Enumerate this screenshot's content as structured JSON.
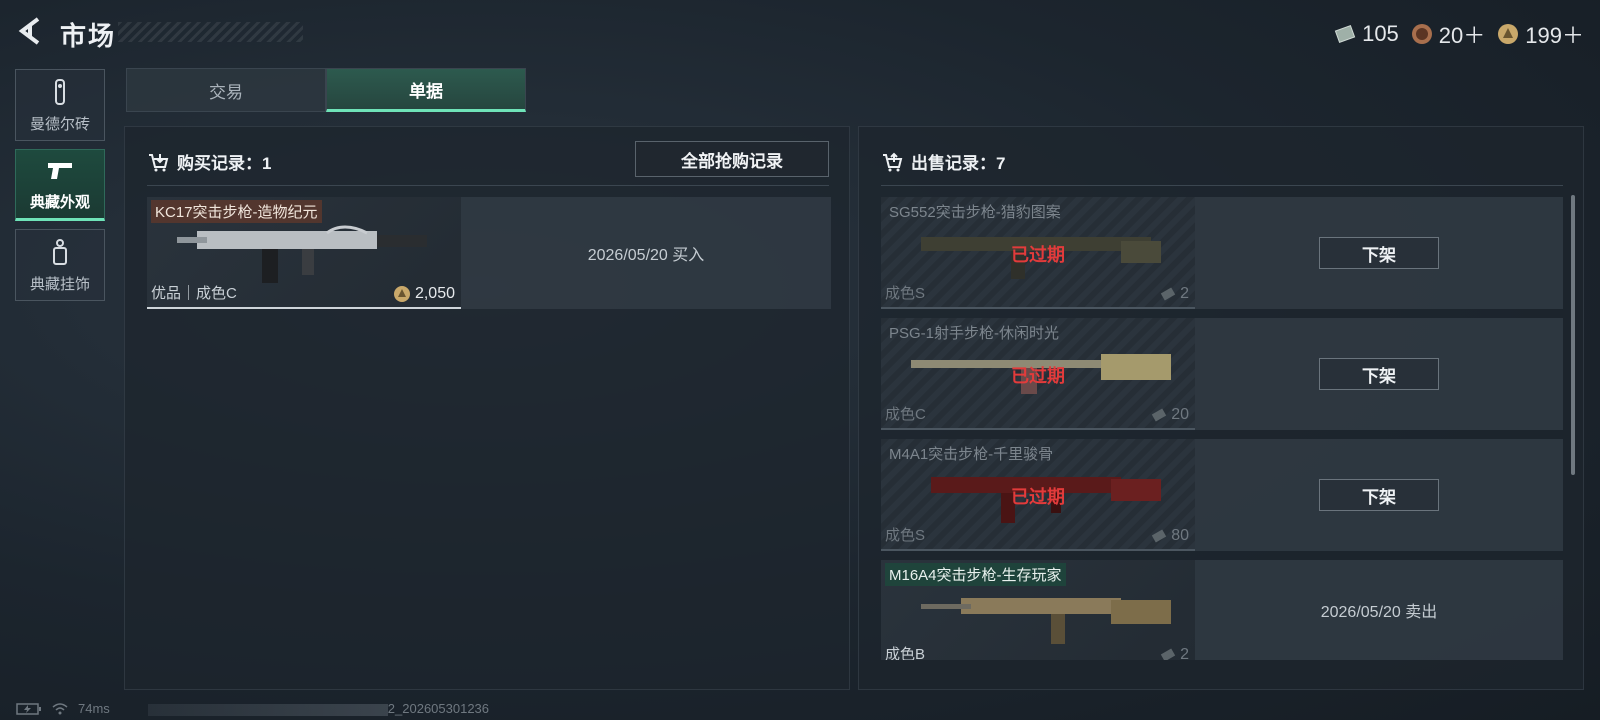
{
  "header": {
    "title": "市场",
    "currencies": [
      {
        "icon": "ticket-icon",
        "value": "105"
      },
      {
        "icon": "badge-coin-icon",
        "value": "20＋"
      },
      {
        "icon": "gold-coin-icon",
        "value": "199＋"
      }
    ]
  },
  "sidebar": {
    "items": [
      {
        "label": "曼德尔砖",
        "icon": "brick-icon",
        "active": false
      },
      {
        "label": "典藏外观",
        "icon": "pistol-icon",
        "active": true
      },
      {
        "label": "典藏挂饰",
        "icon": "charm-icon",
        "active": false
      }
    ]
  },
  "tabs": [
    {
      "label": "交易",
      "active": false
    },
    {
      "label": "单据",
      "active": true
    }
  ],
  "purchase": {
    "heading": "购买记录：1",
    "all_button": "全部抢购记录",
    "records": [
      {
        "name": "KC17突击步枪-造物纪元",
        "grade": "优品｜成色C",
        "price": "2,050",
        "info": "2026/05/20 买入"
      }
    ]
  },
  "sales": {
    "heading": "出售记录：7",
    "records": [
      {
        "name": "SG552突击步枪-猎豹图案",
        "grade": "成色S",
        "qty": "2",
        "expired": "已过期",
        "action": "下架"
      },
      {
        "name": "PSG-1射手步枪-休闲时光",
        "grade": "成色C",
        "qty": "20",
        "expired": "已过期",
        "action": "下架"
      },
      {
        "name": "M4A1突击步枪-千里骏骨",
        "grade": "成色S",
        "qty": "80",
        "expired": "已过期",
        "action": "下架"
      },
      {
        "name": "M16A4突击步枪-生存玩家",
        "grade": "成色B",
        "qty": "2",
        "info": "2026/05/20 卖出"
      }
    ]
  },
  "status": {
    "ping": "74ms",
    "version": "2_202605301236"
  },
  "colors": {
    "accent": "#6fe3b8",
    "expired": "#e23b3b",
    "active_tab_bg": "#2d5a4e"
  }
}
